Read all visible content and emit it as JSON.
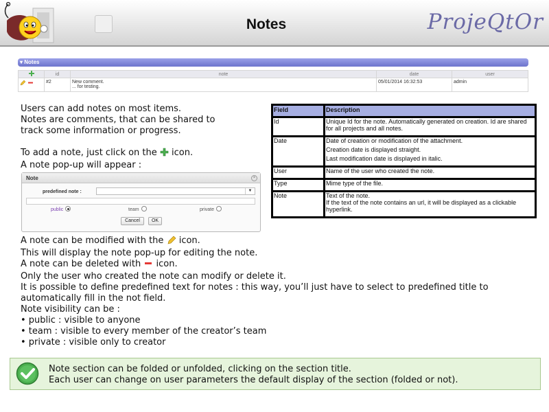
{
  "header": {
    "title": "Notes",
    "brand": "ProjeQtOr"
  },
  "notes_section": {
    "section_title": "▾ Notes",
    "columns": [
      "",
      "id",
      "note",
      "date",
      "user"
    ],
    "row": {
      "id": "#2",
      "note_line1": "New comment.",
      "note_line2": "... for testing.",
      "date": "05/01/2014 16:32:53",
      "user": "admin"
    }
  },
  "intro": {
    "line1": "Users can add notes on most items.",
    "line2": "Notes are comments, that can be shared to",
    "line3": "track some information or progress.",
    "add_prefix": "To add a note, just click on the",
    "add_suffix": "icon.",
    "popup_appear": "A note pop-up will appear :"
  },
  "popup": {
    "title": "Note",
    "close": "×",
    "predefined_label": "predefined note :",
    "select_arrow": "▼",
    "radio_public": "public",
    "radio_team": "team",
    "radio_private": "private",
    "selected_visibility": "public",
    "cancel": "Cancel",
    "ok": "OK"
  },
  "body_text": {
    "modify_prefix": "A note can be modified with the",
    "modify_suffix": "icon.",
    "display_popup": "This will display the note pop-up for editing the note.",
    "delete_prefix": "A note can be deleted with",
    "delete_suffix": "icon.",
    "only_user": "Only the user who created the note can modify or delete it.",
    "predefined_line1": "It is possible to define predefined text for notes : this way, you’ll just have to select to predefined title to",
    "predefined_line2": "automatically fill in the not field.",
    "visibility_title": "Note visibility can be :",
    "vis_public": "• public : visible to anyone",
    "vis_team": "• team : visible to every member of the creator’s team",
    "vis_private": "• private : visible only to creator"
  },
  "field_table": {
    "header_field": "Field",
    "header_description": "Description",
    "rows": [
      {
        "field": "Id",
        "desc": [
          "Unique Id for the note. Automatically generated on creation. Id are shared for all projects and all notes."
        ]
      },
      {
        "field": "Date",
        "desc": [
          "Date of creation or modification of the attachment.",
          "Creation date is displayed straight.",
          "Last modification date is displayed in italic."
        ]
      },
      {
        "field": "User",
        "desc": [
          "Name of the user who created the note."
        ]
      },
      {
        "field": "Type",
        "desc": [
          "Mime type of the file."
        ]
      },
      {
        "field": "Note",
        "desc": [
          "Text of the note.",
          "If the text of the note contains an url, it will be displayed as a clickable hyperlink."
        ]
      }
    ]
  },
  "tip": {
    "line1": "Note section can be folded or unfolded, clicking on the section title.",
    "line2": "Each user can change on user parameters the default display of the section (folded or not)."
  },
  "colors": {
    "brand": "#6b6aa6",
    "section_bar": "#7d84d8",
    "table_header": "#a6aee2",
    "tip_background": "#e6f4dc",
    "add_icon": "#4caf50",
    "delete_icon": "#e53935",
    "edit_icon": "#f0c030"
  },
  "icons": [
    "logo-icon",
    "add-icon",
    "edit-icon",
    "delete-icon",
    "close-icon",
    "checkmark-icon"
  ]
}
